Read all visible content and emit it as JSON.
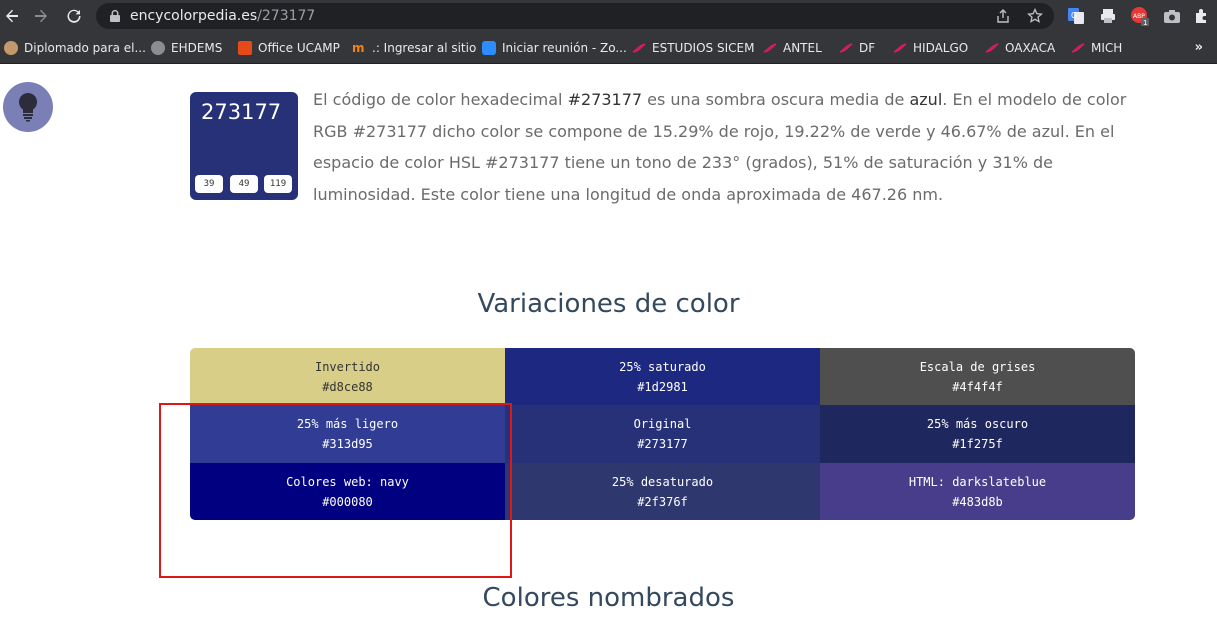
{
  "browser": {
    "url_domain": "encycolorpedia.es",
    "url_path": "/273177"
  },
  "bookmarks": [
    {
      "label": "Diplomado para el...",
      "icon": "circle-favicon-icon"
    },
    {
      "label": "EHDEMS",
      "icon": "globe-icon"
    },
    {
      "label": "Office UCAMP",
      "icon": "office-icon"
    },
    {
      "label": ".: Ingresar al sitio",
      "icon": "moodle-icon"
    },
    {
      "label": "Iniciar reunión - Zo...",
      "icon": "zoom-icon"
    },
    {
      "label": "ESTUDIOS SICEM",
      "icon": "swirl-icon"
    },
    {
      "label": "ANTEL",
      "icon": "swirl-icon"
    },
    {
      "label": "DF",
      "icon": "swirl-icon"
    },
    {
      "label": "HIDALGO",
      "icon": "swirl-icon"
    },
    {
      "label": "OAXACA",
      "icon": "swirl-icon"
    },
    {
      "label": "MICH",
      "icon": "swirl-icon"
    }
  ],
  "bookmarks_more": "»",
  "swatch": {
    "hex": "273177",
    "color": "#273177",
    "r": "39",
    "g": "49",
    "b": "119"
  },
  "intro": {
    "p1": "El código de color hexadecimal ",
    "hex": "#273177",
    "p2": " es una sombra oscura media de ",
    "name": "azul",
    "p3": ". En el modelo de color RGB #273177 dicho color se compone de 15.29% de rojo, 19.22% de verde y 46.67% de azul. En el espacio de color HSL #273177 tiene un tono de 233° (grados), 51% de saturación y 31% de luminosidad. Este color tiene una longitud de onda aproximada de 467.26 nm."
  },
  "variations_title": "Variaciones de color",
  "variations": [
    {
      "label": "Invertido",
      "hex": "#d8ce88",
      "bg": "#d8ce88",
      "fg": "#333333"
    },
    {
      "label": "25% saturado",
      "hex": "#1d2981",
      "bg": "#1d2981",
      "fg": "#ffffff"
    },
    {
      "label": "Escala de grises",
      "hex": "#4f4f4f",
      "bg": "#4f4f4f",
      "fg": "#ffffff"
    },
    {
      "label": "25% más ligero",
      "hex": "#313d95",
      "bg": "#313d95",
      "fg": "#ffffff"
    },
    {
      "label": "Original",
      "hex": "#273177",
      "bg": "#273177",
      "fg": "#ffffff"
    },
    {
      "label": "25% más oscuro",
      "hex": "#1f275f",
      "bg": "#1f275f",
      "fg": "#ffffff"
    },
    {
      "label": "Colores web: navy",
      "hex": "#000080",
      "bg": "#000080",
      "fg": "#ffffff"
    },
    {
      "label": "25% desaturado",
      "hex": "#2f376f",
      "bg": "#2f376f",
      "fg": "#ffffff"
    },
    {
      "label": "HTML: darkslateblue",
      "hex": "#483d8b",
      "bg": "#483d8b",
      "fg": "#ffffff"
    }
  ],
  "named_title": "Colores nombrados",
  "colors": {
    "chrome_bg": "#35363a",
    "omnibox_bg": "#202124",
    "highlight": "#e01717"
  }
}
